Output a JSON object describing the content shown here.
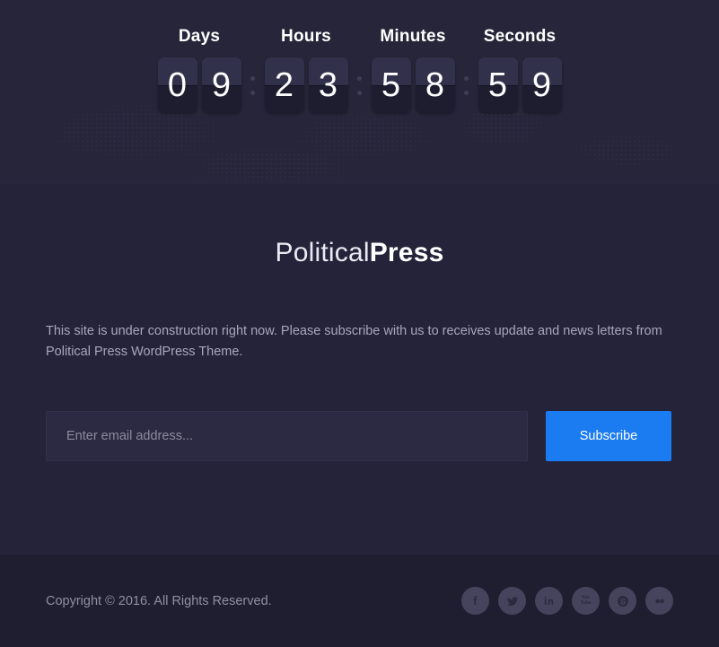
{
  "countdown": {
    "groups": [
      {
        "label": "Days",
        "digits": [
          "0",
          "9"
        ]
      },
      {
        "label": "Hours",
        "digits": [
          "2",
          "3"
        ]
      },
      {
        "label": "Minutes",
        "digits": [
          "5",
          "8"
        ]
      },
      {
        "label": "Seconds",
        "digits": [
          "5",
          "9"
        ]
      }
    ]
  },
  "brand": {
    "name_light": "Political",
    "name_bold": "Press"
  },
  "main": {
    "description": "This site is under construction right now. Please subscribe with us to receives update and news letters from Political Press WordPress Theme.",
    "email_placeholder": "Enter email address...",
    "email_value": "",
    "subscribe_label": "Subscribe"
  },
  "footer": {
    "copyright": "Copyright © 2016. All Rights Reserved.",
    "socials": [
      {
        "name": "facebook",
        "title": "Facebook"
      },
      {
        "name": "twitter",
        "title": "Twitter"
      },
      {
        "name": "linkedin",
        "title": "LinkedIn"
      },
      {
        "name": "youtube",
        "title": "YouTube",
        "line1": "You",
        "line2": "Tube"
      },
      {
        "name": "skype",
        "title": "Skype"
      },
      {
        "name": "flickr",
        "title": "Flickr"
      }
    ]
  },
  "colors": {
    "hero_bg": "#262539",
    "body_bg": "#24233a",
    "footer_bg": "#1f1e31",
    "accent_blue": "#1a7cf0",
    "card_top": "#32314b",
    "card_bottom": "#1e1d30",
    "social_bg": "#45445c",
    "muted_text": "#a7a8bb"
  }
}
